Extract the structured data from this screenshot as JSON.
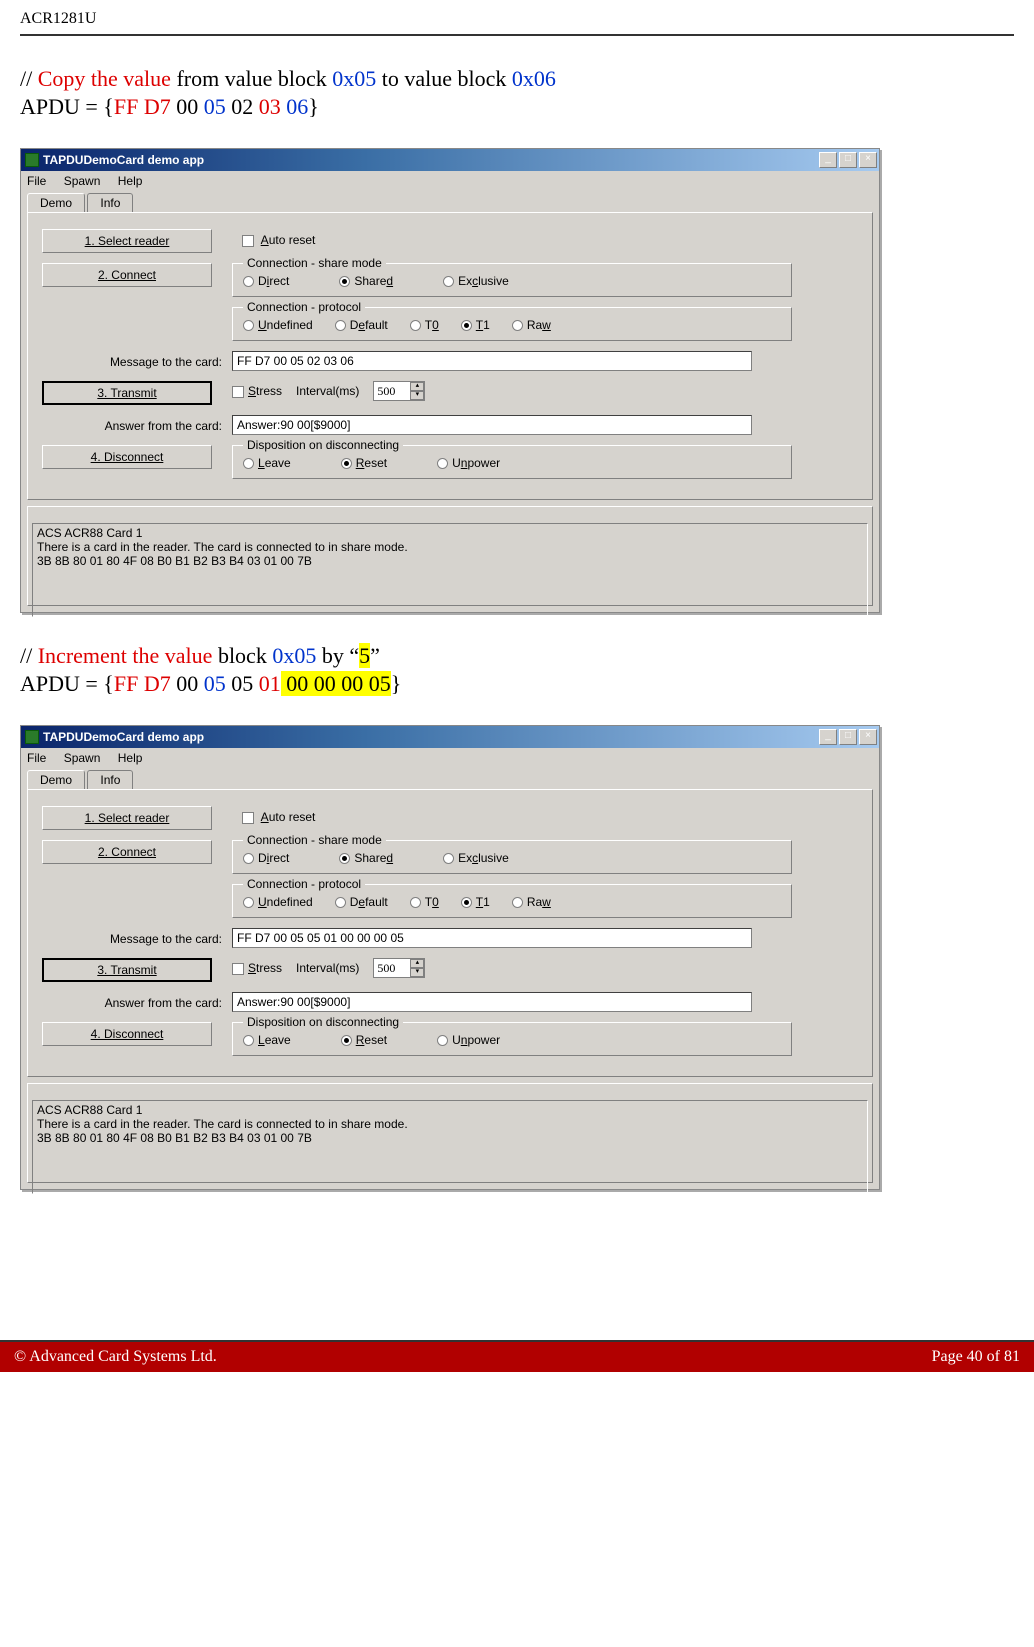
{
  "doc": {
    "header": "ACR1281U",
    "section1": {
      "comment_prefix": "// ",
      "comment_action": "Copy the value",
      "comment_mid1": " from value block ",
      "comment_block_from": "0x05",
      "comment_mid2": " to value block ",
      "comment_block_to": "0x06",
      "apdu_prefix": "APDU = {",
      "apdu_p1": "FF D7",
      "apdu_p2": " 00 ",
      "apdu_p3": "05",
      "apdu_p4": " 02 ",
      "apdu_p5": "03",
      "apdu_p6": " 06",
      "apdu_suffix": "}"
    },
    "section2": {
      "comment_prefix": "// ",
      "comment_action": "Increment the value",
      "comment_mid1": " block ",
      "comment_block": "0x05",
      "comment_mid2": " by “",
      "comment_by": "5",
      "comment_close": "”",
      "apdu_prefix": "APDU = {",
      "apdu_p1": "FF D7",
      "apdu_p2": " 00 ",
      "apdu_p3": "05",
      "apdu_p4": " 05 ",
      "apdu_p5": "01",
      "apdu_p6_hl": " 00 00 00 05",
      "apdu_suffix": "}"
    },
    "footer_left": "© Advanced Card Systems Ltd.",
    "footer_right": "Page 40 of 81"
  },
  "app": {
    "title": "TAPDUDemoCard demo app",
    "menu": {
      "file": "File",
      "spawn": "Spawn",
      "help": "Help"
    },
    "tabs": {
      "demo": "Demo",
      "info": "Info"
    },
    "buttons": {
      "select": "1. Select reader",
      "connect": "2. Connect",
      "transmit": "3. Transmit",
      "disconnect": "4. Disconnect"
    },
    "autoreset": "Auto reset",
    "share": {
      "legend": "Connection - share mode",
      "direct": "Direct",
      "shared": "Shared",
      "exclusive": "Exclusive"
    },
    "protocol": {
      "legend": "Connection - protocol",
      "undefined": "Undefined",
      "default": "Default",
      "t0": "T0",
      "t1": "T1",
      "raw": "Raw"
    },
    "msg_label": "Message to the card:",
    "stress": "Stress",
    "interval_label": "Interval(ms)",
    "interval_value": "500",
    "answer_label": "Answer from the card:",
    "answer_value": "Answer:90 00[$9000]",
    "disposition": {
      "legend": "Disposition on disconnecting",
      "leave": "Leave",
      "reset": "Reset",
      "unpower": "Unpower"
    },
    "status": "ACS ACR88 Card 1\nThere is a card in the reader. The card is connected to in share mode.\n3B 8B 80 01 80 4F 08 B0 B1 B2 B3 B4 03 01 00 7B"
  },
  "screens": {
    "s1": {
      "message": "FF D7 00 05 02 03 06"
    },
    "s2": {
      "message": "FF D7 00 05 05 01 00 00 00 05"
    }
  }
}
